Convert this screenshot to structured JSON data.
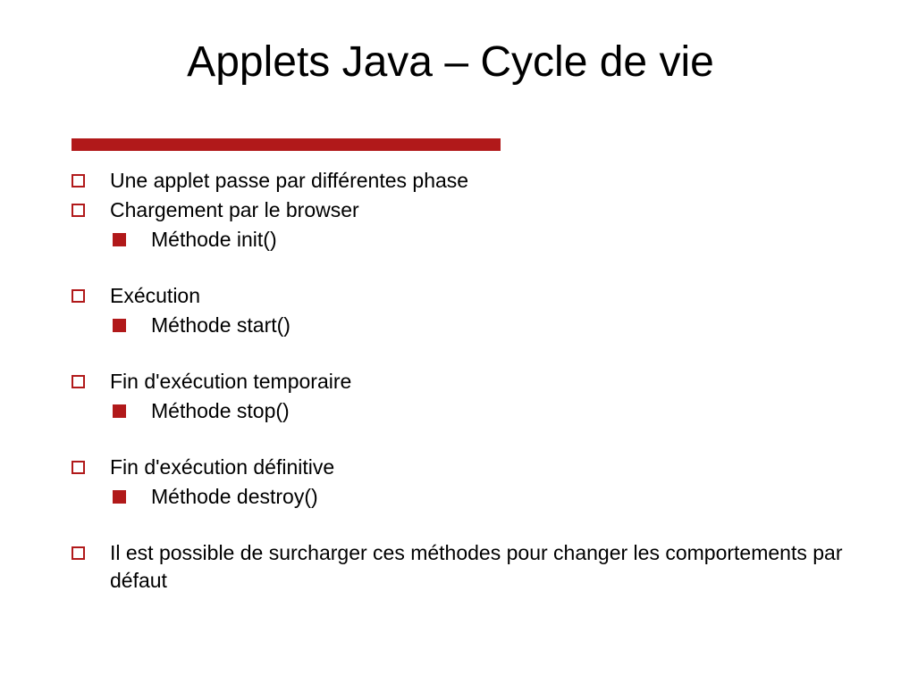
{
  "title": "Applets Java – Cycle de vie",
  "items": [
    {
      "text": "Une applet passe par différentes phase",
      "sub": null,
      "spaceAfter": false
    },
    {
      "text": "Chargement par le browser",
      "sub": "Méthode init()",
      "spaceAfter": true
    },
    {
      "text": "Exécution",
      "sub": "Méthode start()",
      "spaceAfter": true
    },
    {
      "text": "Fin d'exécution temporaire",
      "sub": "Méthode stop()",
      "spaceAfter": true
    },
    {
      "text": "Fin d'exécution définitive",
      "sub": "Méthode destroy()",
      "spaceAfter": true
    },
    {
      "text": "Il est possible de surcharger ces méthodes pour changer les comportements par défaut",
      "sub": null,
      "spaceAfter": false
    }
  ]
}
